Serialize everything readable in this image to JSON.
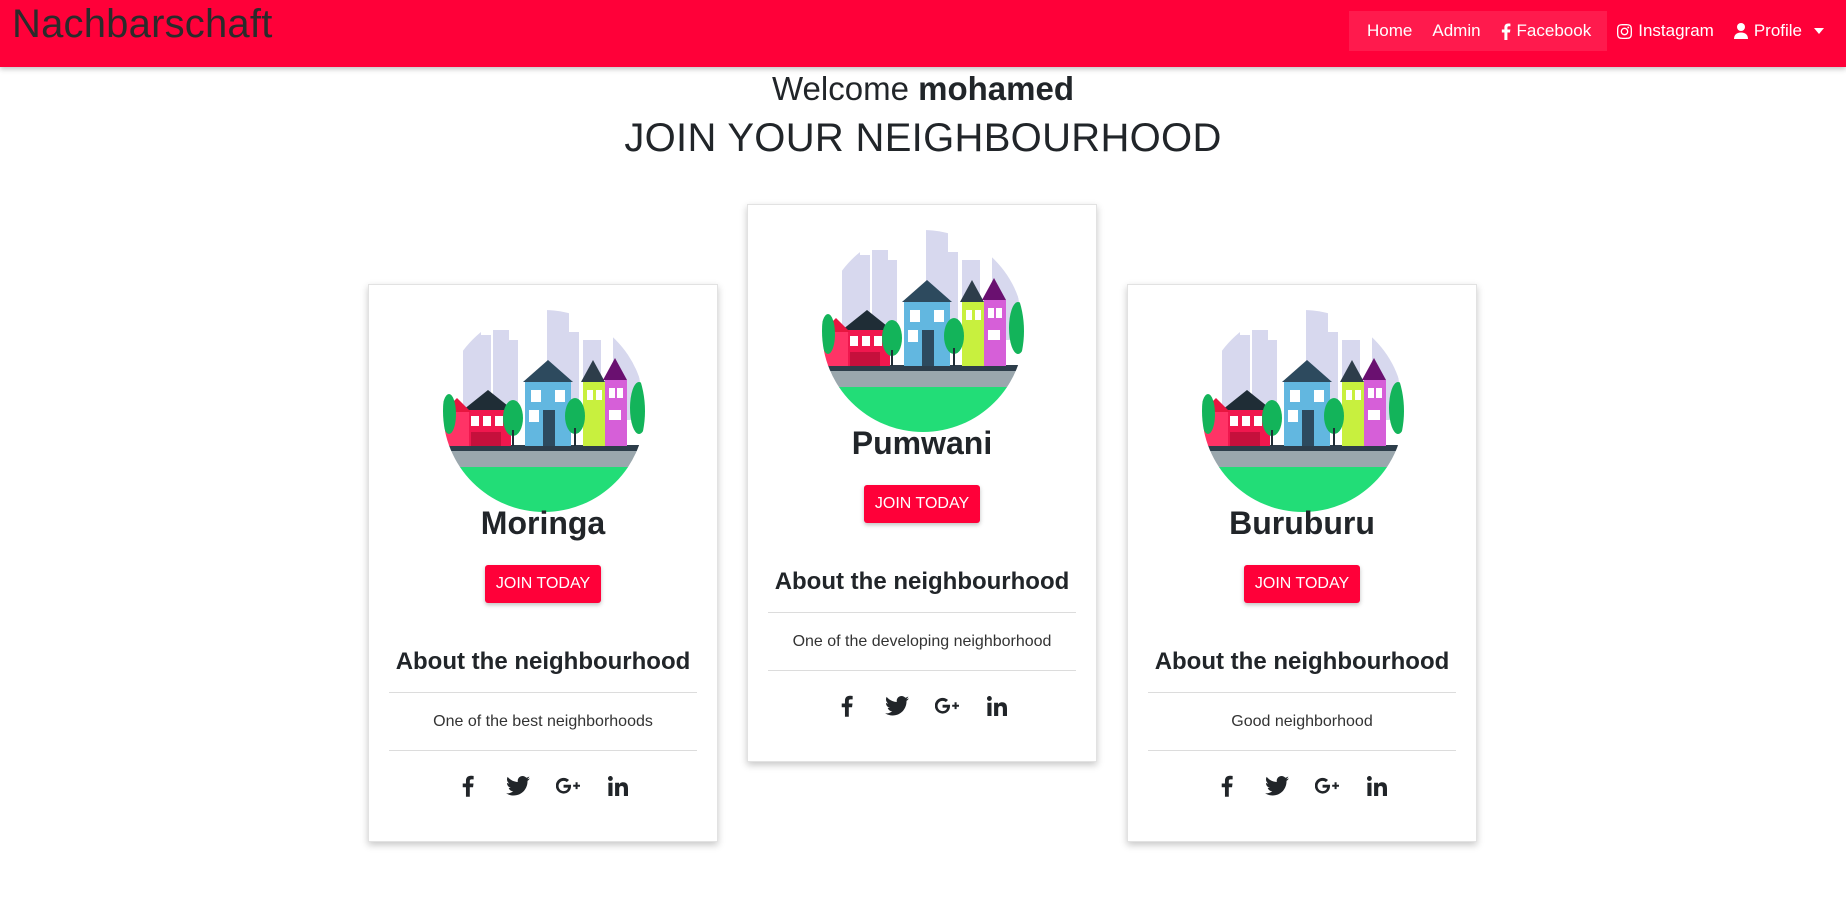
{
  "navbar": {
    "brand": "Nachbarschaft",
    "links": {
      "home": "Home",
      "admin": "Admin",
      "facebook": "Facebook",
      "instagram": "Instagram",
      "profile": "Profile"
    },
    "icons": {
      "facebook": "facebook-icon",
      "instagram": "instagram-icon",
      "profile": "user-icon"
    }
  },
  "welcome": {
    "prefix": "Welcome",
    "username": "mohamed"
  },
  "headline": "JOIN YOUR NEIGHBOURHOOD",
  "cards": [
    {
      "name": "Moringa",
      "join_label": "JOIN TODAY",
      "about_title": "About the neighbourhood",
      "description": "One of the best neighborhoods"
    },
    {
      "name": "Pumwani",
      "join_label": "JOIN TODAY",
      "about_title": "About the neighbourhood",
      "description": "One of the developing neighborhood"
    },
    {
      "name": "Buruburu",
      "join_label": "JOIN TODAY",
      "about_title": "About the neighbourhood",
      "description": "Good neighborhood"
    }
  ],
  "social_icons": [
    "facebook-icon",
    "twitter-icon",
    "google-plus-icon",
    "linkedin-icon"
  ],
  "colors": {
    "brand": "#ff0039",
    "text": "#212529",
    "white": "#ffffff"
  }
}
